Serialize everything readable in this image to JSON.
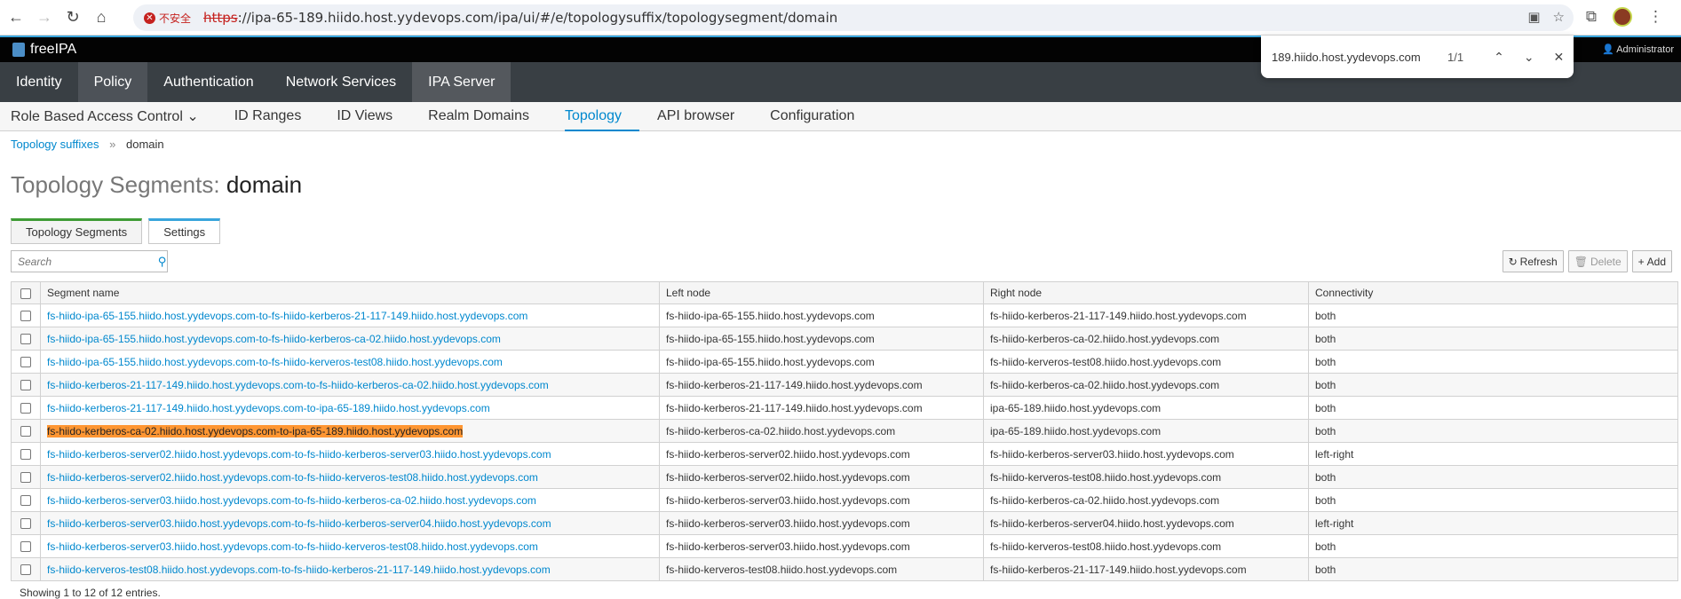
{
  "browser": {
    "security_label": "不安全",
    "url_scheme": "https",
    "url_rest": "://ipa-65-189.hiido.host.yydevops.com/ipa/ui/#/e/topologysuffix/topologysegment/domain"
  },
  "findbar": {
    "query": "189.hiido.host.yydevops.com",
    "count": "1/1"
  },
  "brand": {
    "name": "freeIPA",
    "user": "Administrator"
  },
  "topnav": [
    "Identity",
    "Policy",
    "Authentication",
    "Network Services",
    "IPA Server"
  ],
  "subnav": [
    "Role Based Access Control ⌄",
    "ID Ranges",
    "ID Views",
    "Realm Domains",
    "Topology",
    "API browser",
    "Configuration"
  ],
  "breadcrumb": {
    "parent": "Topology suffixes",
    "current": "domain"
  },
  "page": {
    "title_prefix": "Topology Segments: ",
    "title_name": "domain"
  },
  "tabs": [
    "Topology Segments",
    "Settings"
  ],
  "search": {
    "placeholder": "Search"
  },
  "actions": {
    "refresh": "Refresh",
    "delete": "Delete",
    "add": "Add"
  },
  "table": {
    "headers": [
      "Segment name",
      "Left node",
      "Right node",
      "Connectivity"
    ],
    "rows": [
      [
        "fs-hiido-ipa-65-155.hiido.host.yydevops.com-to-fs-hiido-kerberos-21-117-149.hiido.host.yydevops.com",
        "fs-hiido-ipa-65-155.hiido.host.yydevops.com",
        "fs-hiido-kerberos-21-117-149.hiido.host.yydevops.com",
        "both"
      ],
      [
        "fs-hiido-ipa-65-155.hiido.host.yydevops.com-to-fs-hiido-kerberos-ca-02.hiido.host.yydevops.com",
        "fs-hiido-ipa-65-155.hiido.host.yydevops.com",
        "fs-hiido-kerberos-ca-02.hiido.host.yydevops.com",
        "both"
      ],
      [
        "fs-hiido-ipa-65-155.hiido.host.yydevops.com-to-fs-hiido-kerveros-test08.hiido.host.yydevops.com",
        "fs-hiido-ipa-65-155.hiido.host.yydevops.com",
        "fs-hiido-kerveros-test08.hiido.host.yydevops.com",
        "both"
      ],
      [
        "fs-hiido-kerberos-21-117-149.hiido.host.yydevops.com-to-fs-hiido-kerberos-ca-02.hiido.host.yydevops.com",
        "fs-hiido-kerberos-21-117-149.hiido.host.yydevops.com",
        "fs-hiido-kerberos-ca-02.hiido.host.yydevops.com",
        "both"
      ],
      [
        "fs-hiido-kerberos-21-117-149.hiido.host.yydevops.com-to-ipa-65-189.hiido.host.yydevops.com",
        "fs-hiido-kerberos-21-117-149.hiido.host.yydevops.com",
        "ipa-65-189.hiido.host.yydevops.com",
        "both"
      ],
      [
        "fs-hiido-kerberos-ca-02.hiido.host.yydevops.com-to-ipa-65-189.hiido.host.yydevops.com",
        "fs-hiido-kerberos-ca-02.hiido.host.yydevops.com",
        "ipa-65-189.hiido.host.yydevops.com",
        "both"
      ],
      [
        "fs-hiido-kerberos-server02.hiido.host.yydevops.com-to-fs-hiido-kerberos-server03.hiido.host.yydevops.com",
        "fs-hiido-kerberos-server02.hiido.host.yydevops.com",
        "fs-hiido-kerberos-server03.hiido.host.yydevops.com",
        "left-right"
      ],
      [
        "fs-hiido-kerberos-server02.hiido.host.yydevops.com-to-fs-hiido-kerveros-test08.hiido.host.yydevops.com",
        "fs-hiido-kerberos-server02.hiido.host.yydevops.com",
        "fs-hiido-kerveros-test08.hiido.host.yydevops.com",
        "both"
      ],
      [
        "fs-hiido-kerberos-server03.hiido.host.yydevops.com-to-fs-hiido-kerberos-ca-02.hiido.host.yydevops.com",
        "fs-hiido-kerberos-server03.hiido.host.yydevops.com",
        "fs-hiido-kerberos-ca-02.hiido.host.yydevops.com",
        "both"
      ],
      [
        "fs-hiido-kerberos-server03.hiido.host.yydevops.com-to-fs-hiido-kerberos-server04.hiido.host.yydevops.com",
        "fs-hiido-kerberos-server03.hiido.host.yydevops.com",
        "fs-hiido-kerberos-server04.hiido.host.yydevops.com",
        "left-right"
      ],
      [
        "fs-hiido-kerberos-server03.hiido.host.yydevops.com-to-fs-hiido-kerveros-test08.hiido.host.yydevops.com",
        "fs-hiido-kerberos-server03.hiido.host.yydevops.com",
        "fs-hiido-kerveros-test08.hiido.host.yydevops.com",
        "both"
      ],
      [
        "fs-hiido-kerveros-test08.hiido.host.yydevops.com-to-fs-hiido-kerberos-21-117-149.hiido.host.yydevops.com",
        "fs-hiido-kerveros-test08.hiido.host.yydevops.com",
        "fs-hiido-kerberos-21-117-149.hiido.host.yydevops.com",
        "both"
      ]
    ],
    "highlighted_row": 5
  },
  "footer": {
    "count_text": "Showing 1 to 12 of 12 entries."
  }
}
